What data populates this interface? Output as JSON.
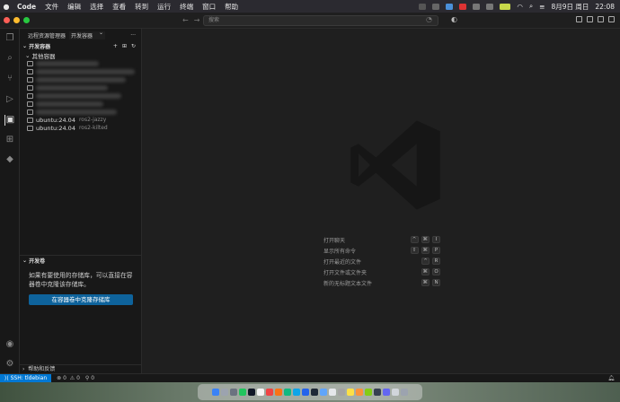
{
  "menubar": {
    "apple_icon": "apple-icon",
    "app": "Code",
    "items": [
      "文件",
      "编辑",
      "选择",
      "查看",
      "转到",
      "运行",
      "终端",
      "窗口",
      "帮助"
    ],
    "date": "8月9日 周日",
    "time": "22:08"
  },
  "titlebar": {
    "search_placeholder": "搜索"
  },
  "sidebar": {
    "header": "远程资源管理器",
    "dropdown": "开发容器",
    "more": "···",
    "section_title": "开发容器",
    "group": "其他容器",
    "containers": [
      {
        "name": "ubuntu:24.04",
        "tag": "ros2-jazzy"
      },
      {
        "name": "ubuntu:24.04",
        "tag": "ros2-kilted"
      }
    ],
    "volumes": {
      "title": "开发卷",
      "description": "如果有要使用的存储库，可以直接在容器卷中克隆该存储库。",
      "button": "在容器卷中克隆存储库"
    },
    "help": "帮助和反馈"
  },
  "editor": {
    "shortcuts": [
      {
        "label": "打开聊天",
        "keys": [
          "^",
          "⌘",
          "I"
        ]
      },
      {
        "label": "显示所有命令",
        "keys": [
          "⇧",
          "⌘",
          "P"
        ]
      },
      {
        "label": "打开最近的文件",
        "keys": [
          "^",
          "R"
        ]
      },
      {
        "label": "打开文件或文件夹",
        "keys": [
          "⌘",
          "O"
        ]
      },
      {
        "label": "新的无标题文本文件",
        "keys": [
          "⌘",
          "N"
        ]
      }
    ]
  },
  "statusbar": {
    "remote": "SSH: tldebian",
    "errors": "0",
    "warnings": "0",
    "ports": "0"
  },
  "colors": {
    "accent": "#0078d4",
    "button": "#0e639c",
    "editor_bg": "#1f1f1f",
    "sidebar_bg": "#181818"
  }
}
